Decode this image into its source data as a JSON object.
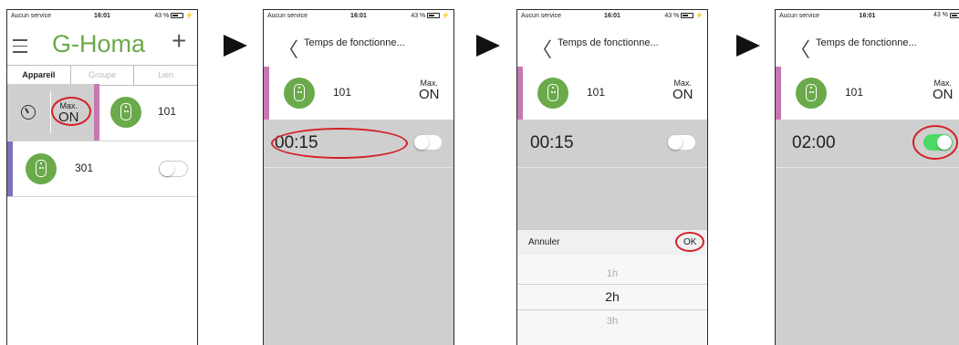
{
  "status": {
    "carrier": "Aucun service",
    "time": "16:01",
    "battery": "43 %"
  },
  "colors": {
    "green": "#6aaa4b",
    "pink": "#c678b0",
    "purple": "#7b73b8",
    "gray": "#cfcfcf",
    "red": "#d42027",
    "toggle_on": "#4cd964"
  },
  "screen1": {
    "title": "G-Homa",
    "tabs": [
      "Appareil",
      "Groupe",
      "Lien"
    ],
    "timer_max": "Max.",
    "timer_on": "ON",
    "device1": "101",
    "device2": "301"
  },
  "screen2": {
    "nav_title": "Temps de fonctionne...",
    "device": "101",
    "max": "Max.",
    "on": "ON",
    "timer": "00:15",
    "toggle_on": false
  },
  "screen3": {
    "nav_title": "Temps de fonctionne...",
    "device": "101",
    "max": "Max.",
    "on": "ON",
    "timer": "00:15",
    "toggle_on": false,
    "cancel": "Annuler",
    "ok": "OK",
    "picker": [
      "1h",
      "2h",
      "3h"
    ],
    "picker_selected": "2h"
  },
  "screen4": {
    "nav_title": "Temps de fonctionne...",
    "device": "101",
    "max": "Max.",
    "on": "ON",
    "timer": "02:00",
    "toggle_on": true
  }
}
